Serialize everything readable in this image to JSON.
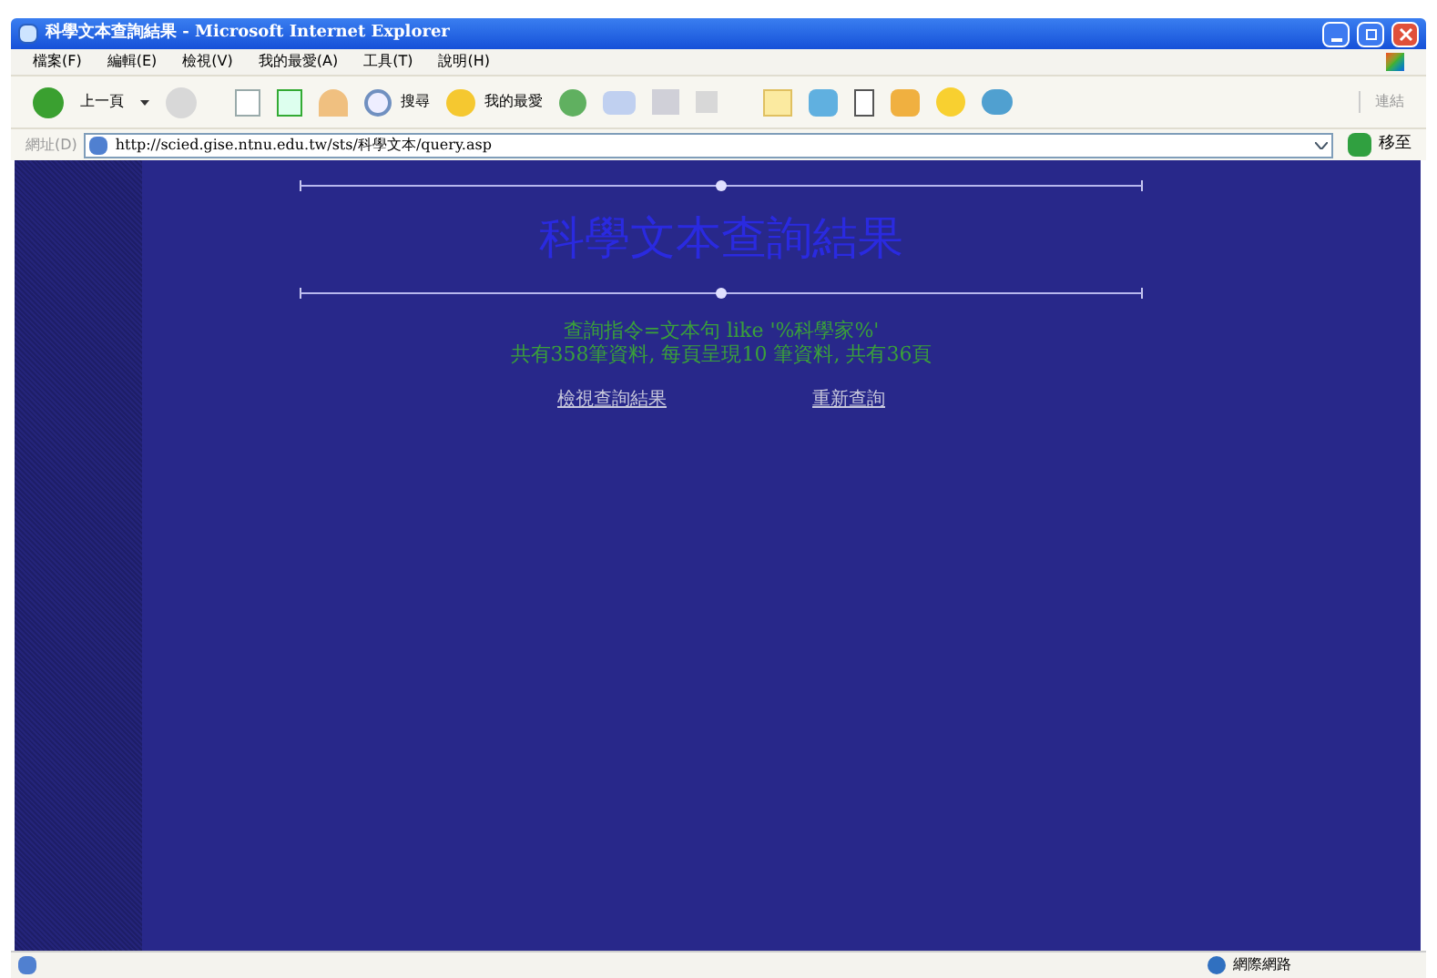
{
  "window": {
    "title": "科學文本查詢結果 - Microsoft Internet Explorer"
  },
  "menu": [
    "檔案(F)",
    "編輯(E)",
    "檢視(V)",
    "我的最愛(A)",
    "工具(T)",
    "說明(H)"
  ],
  "toolbar": {
    "back": "上一頁",
    "search": "搜尋",
    "favorites": "我的最愛",
    "links": "連結"
  },
  "address": {
    "label": "網址(D)",
    "value": "http://scied.gise.ntnu.edu.tw/sts/科學文本/query.asp",
    "go": "移至"
  },
  "page": {
    "heading": "科學文本查詢結果",
    "query": "查詢指令=文本句 like '%科學家%'",
    "summary": "共有358筆資料, 每頁呈現10 筆資料, 共有36頁",
    "links": [
      "檢視查詢結果",
      "重新查詢"
    ]
  },
  "status_bar": {
    "zone": "網際網路"
  }
}
